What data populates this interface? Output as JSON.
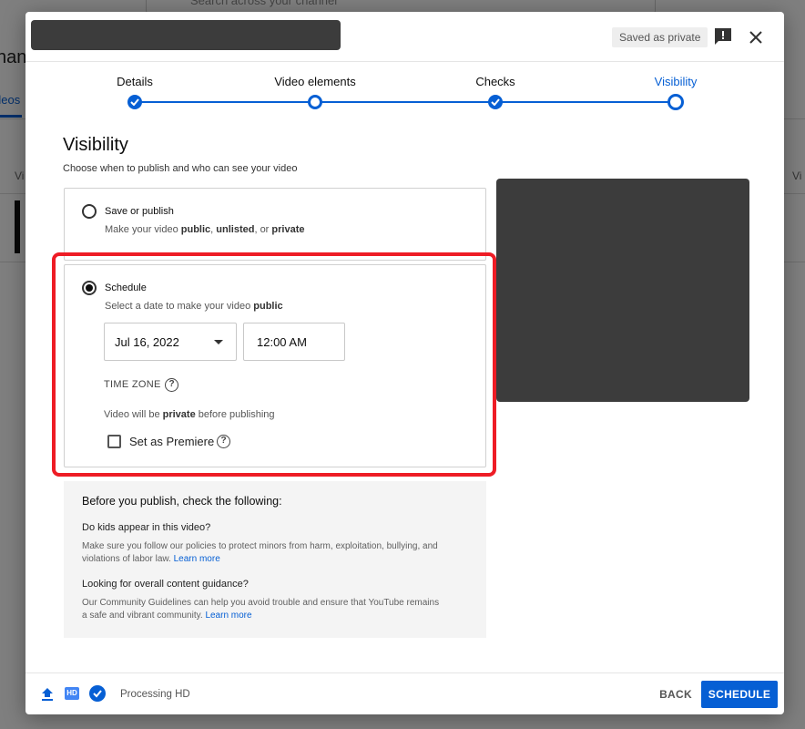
{
  "background": {
    "search_placeholder": "Search across your channel",
    "title_fragment": "han",
    "tab_fragment": "deos",
    "col_left": "Vi",
    "col_right": "Vi"
  },
  "header": {
    "saved_status": "Saved as private"
  },
  "stepper": {
    "steps": [
      {
        "label": "Details",
        "state": "done"
      },
      {
        "label": "Video elements",
        "state": "open"
      },
      {
        "label": "Checks",
        "state": "done"
      },
      {
        "label": "Visibility",
        "state": "active"
      }
    ]
  },
  "visibility": {
    "title": "Visibility",
    "subtitle": "Choose when to publish and who can see your video",
    "save_publish": {
      "title": "Save or publish",
      "desc_prefix": "Make your video ",
      "desc_public": "public",
      "desc_sep1": ", ",
      "desc_unlisted": "unlisted",
      "desc_sep2": ", or ",
      "desc_private": "private"
    },
    "schedule": {
      "title": "Schedule",
      "desc_prefix": "Select a date to make your video ",
      "desc_public": "public",
      "date": "Jul 16, 2022",
      "time": "12:00 AM",
      "timezone_label": "TIME ZONE",
      "private_prefix": "Video will be ",
      "private_word": "private",
      "private_suffix": " before publishing",
      "premiere_label": "Set as Premiere"
    }
  },
  "checklist": {
    "title": "Before you publish, check the following:",
    "q1": "Do kids appear in this video?",
    "a1": "Make sure you follow our policies to protect minors from harm, exploitation, bullying, and violations of labor law.",
    "q2": "Looking for overall content guidance?",
    "a2": "Our Community Guidelines can help you avoid trouble and ensure that YouTube remains a safe and vibrant community.",
    "learn_more": "Learn more"
  },
  "footer": {
    "hd_badge": "HD",
    "processing": "Processing HD",
    "back_label": "BACK",
    "schedule_label": "SCHEDULE"
  },
  "colors": {
    "accent": "#065fd4",
    "highlight": "#ee1c25"
  }
}
